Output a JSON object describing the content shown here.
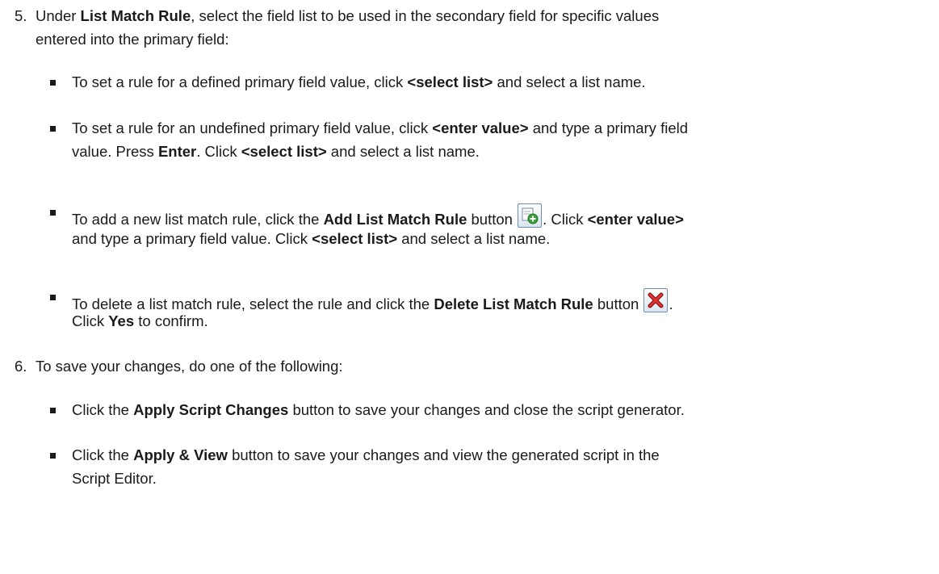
{
  "steps": [
    {
      "number": "5.",
      "lines": [
        {
          "a": "Under ",
          "b": "List Match Rule",
          "c": ", select the field list to be used in the secondary field for specific values"
        },
        {
          "a": "entered into the primary field:"
        }
      ],
      "bullets": [
        {
          "lines": [
            {
              "a": "To set a rule for a defined primary field value, click ",
              "b": "<select list>",
              "c": " and select a list name."
            }
          ]
        },
        {
          "lines": [
            {
              "a": "To set a rule for an undefined primary field value, click ",
              "b": "<enter value>",
              "c": " and type a primary field"
            },
            {
              "a": "value. Press ",
              "b": "Enter",
              "c": ". Click ",
              "d": "<select list>",
              "e": " and select a list name."
            }
          ]
        },
        {
          "lines": [
            {
              "a": "To add a new list match rule, click the ",
              "b": "Add List Match Rule",
              "c": " button ",
              "d": ". Click ",
              "e": "<enter value>"
            },
            {
              "a": "and type a primary field value. Click ",
              "b": "<select list>",
              "c": " and select a list name."
            }
          ]
        },
        {
          "lines": [
            {
              "a": "To delete a list match rule, select the rule and click the ",
              "b": "Delete List Match Rule",
              "c": " button ",
              "d": "."
            },
            {
              "a": "Click ",
              "b": "Yes",
              "c": " to confirm."
            }
          ]
        }
      ]
    },
    {
      "number": "6.",
      "lines": [
        {
          "a": "To save your changes, do one of the following:"
        }
      ],
      "bullets": [
        {
          "lines": [
            {
              "a": "Click the ",
              "b": "Apply Script Changes",
              "c": " button to save your changes and close the script generator."
            }
          ]
        },
        {
          "lines": [
            {
              "a": "Click the ",
              "b": "Apply & View",
              "c": " button to save your changes and view the generated script in the"
            },
            {
              "a": "Script Editor."
            }
          ]
        }
      ]
    }
  ],
  "icons": {
    "add": "add-list-match-rule-icon",
    "delete": "delete-list-match-rule-icon"
  }
}
